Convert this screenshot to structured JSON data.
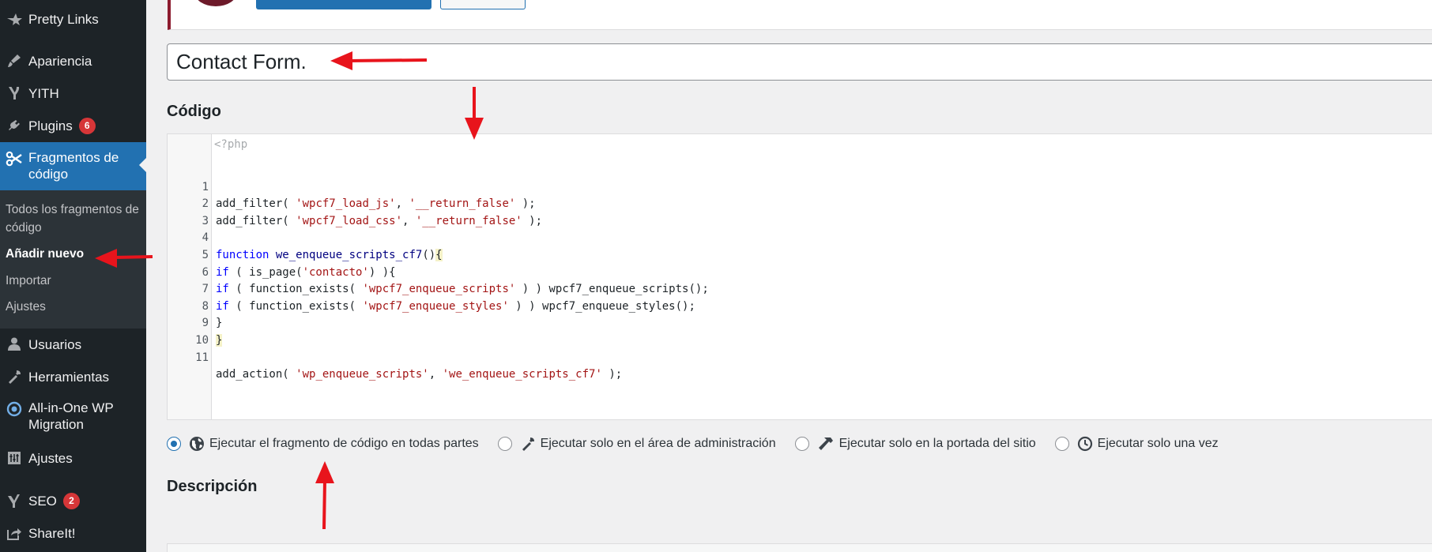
{
  "sidebar": {
    "items": [
      {
        "name": "pretty-links",
        "label": "Pretty Links",
        "icon": "star-icon"
      },
      {
        "name": "apariencia",
        "label": "Apariencia",
        "icon": "paintbrush-icon"
      },
      {
        "name": "yith",
        "label": "YITH",
        "icon": "yith-icon"
      },
      {
        "name": "plugins",
        "label": "Plugins",
        "badge": "6",
        "icon": "plug-icon"
      },
      {
        "name": "fragmentos",
        "label": "Fragmentos de código",
        "icon": "scissors-icon"
      },
      {
        "name": "usuarios",
        "label": "Usuarios",
        "icon": "user-icon"
      },
      {
        "name": "herramientas",
        "label": "Herramientas",
        "icon": "wrench-icon"
      },
      {
        "name": "all-in-one",
        "label": "All-in-One WP Migration",
        "icon": "migration-icon"
      },
      {
        "name": "ajustes",
        "label": "Ajustes",
        "icon": "settings-icon"
      },
      {
        "name": "seo",
        "label": "SEO",
        "badge": "2",
        "icon": "yoast-icon"
      },
      {
        "name": "shareit",
        "label": "ShareIt!",
        "icon": "share-icon"
      }
    ],
    "submenu": [
      {
        "label": "Todos los fragmentos de código"
      },
      {
        "label": "Añadir nuevo"
      },
      {
        "label": "Importar"
      },
      {
        "label": "Ajustes"
      }
    ]
  },
  "editor": {
    "title_value": "Contact Form.",
    "code_heading": "Código",
    "php_open": "<?php",
    "line_numbers": [
      "1",
      "2",
      "3",
      "4",
      "5",
      "6",
      "7",
      "8",
      "9",
      "10",
      "11"
    ],
    "code": {
      "l1": [
        "add_filter( ",
        "'wpcf7_load_js'",
        ", ",
        "'__return_false'",
        " );"
      ],
      "l2": [
        "add_filter( ",
        "'wpcf7_load_css'",
        ", ",
        "'__return_false'",
        " );"
      ],
      "l4": [
        "function",
        " ",
        "we_enqueue_scripts_cf7",
        "()",
        "{"
      ],
      "l5": [
        "if",
        " ( is_page(",
        "'contacto'",
        ") ){"
      ],
      "l6": [
        "if",
        " ( function_exists( ",
        "'wpcf7_enqueue_scripts'",
        " ) ) wpcf7_enqueue_scripts();"
      ],
      "l7": [
        "if",
        " ( function_exists( ",
        "'wpcf7_enqueue_styles'",
        " ) ) wpcf7_enqueue_styles();"
      ],
      "l8": [
        "}"
      ],
      "l9": [
        "}"
      ],
      "l11": [
        "add_action( ",
        "'wp_enqueue_scripts'",
        ", ",
        "'we_enqueue_scripts_cf7'",
        " );"
      ]
    },
    "scope_options": [
      {
        "label": "Ejecutar el fragmento de código en todas partes",
        "icon": "globe-icon",
        "checked": true
      },
      {
        "label": "Ejecutar solo en el área de administración",
        "icon": "wrench-icon",
        "checked": false
      },
      {
        "label": "Ejecutar solo en la portada del sitio",
        "icon": "hammer-icon",
        "checked": false
      },
      {
        "label": "Ejecutar solo una vez",
        "icon": "clock-icon",
        "checked": false
      }
    ],
    "description_heading": "Descripción"
  },
  "colors": {
    "sidebar_bg": "#1d2327",
    "active_bg": "#2271b1",
    "annotation_red": "#e8141c",
    "badge_red": "#d63638"
  }
}
